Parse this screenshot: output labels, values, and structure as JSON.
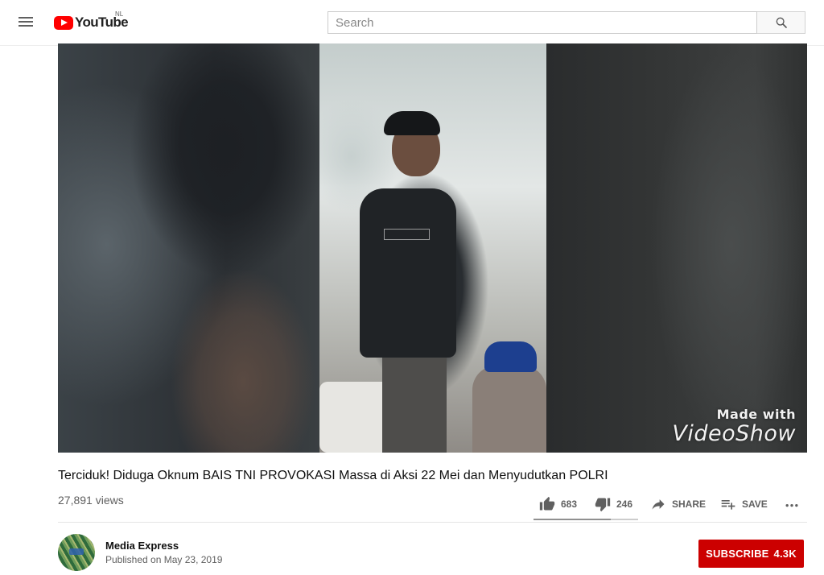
{
  "masthead": {
    "logo_text": "YouTube",
    "region": "NL",
    "search_placeholder": "Search"
  },
  "video": {
    "watermark_top": "Made with",
    "watermark_bottom": "VideoShow",
    "title": "Terciduk! Diduga Oknum BAIS TNI PROVOKASI Massa di Aksi 22 Mei dan Menyudutkan POLRI",
    "views": "27,891 views"
  },
  "actions": {
    "likes": "683",
    "dislikes": "246",
    "share_label": "SHARE",
    "save_label": "SAVE",
    "like_ratio": 0.735
  },
  "channel": {
    "name": "Media Express",
    "published": "Published on May 23, 2019",
    "subscribe_label": "SUBSCRIBE",
    "subscriber_count": "4.3K"
  },
  "colors": {
    "brand_red": "#ff0000",
    "subscribe_red": "#cc0000",
    "text_secondary": "#606060"
  },
  "icons": [
    "menu-icon",
    "youtube-logo-icon",
    "search-icon",
    "thumb-up-icon",
    "thumb-down-icon",
    "share-icon",
    "playlist-add-icon",
    "more-icon"
  ]
}
